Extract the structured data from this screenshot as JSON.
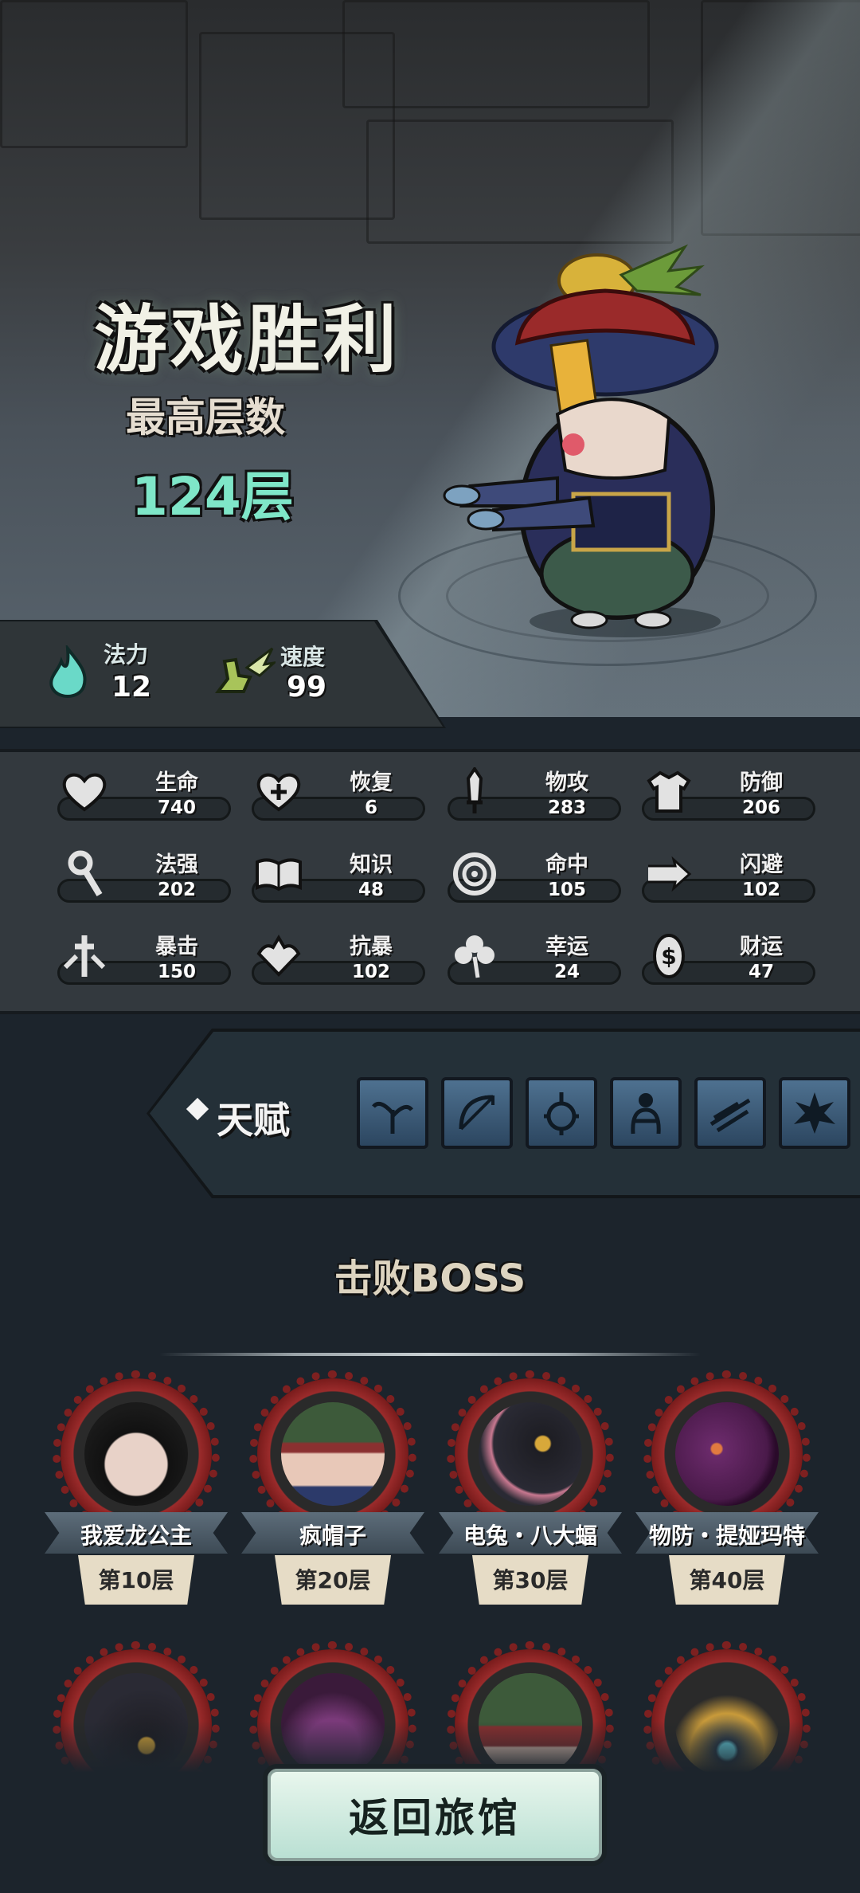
{
  "result": {
    "title": "游戏胜利",
    "subtitle": "最高层数",
    "highest_floor": "124层"
  },
  "top_stats": [
    {
      "label": "法力",
      "value": "12",
      "icon": "mana-flame-icon"
    },
    {
      "label": "速度",
      "value": "99",
      "icon": "winged-boot-icon"
    }
  ],
  "stats": [
    {
      "label": "生命",
      "value": "740",
      "icon": "heart-icon"
    },
    {
      "label": "恢复",
      "value": "6",
      "icon": "heart-plus-icon"
    },
    {
      "label": "物攻",
      "value": "283",
      "icon": "sword-icon"
    },
    {
      "label": "防御",
      "value": "206",
      "icon": "armor-icon"
    },
    {
      "label": "法强",
      "value": "202",
      "icon": "staff-icon"
    },
    {
      "label": "知识",
      "value": "48",
      "icon": "book-icon"
    },
    {
      "label": "命中",
      "value": "105",
      "icon": "target-icon"
    },
    {
      "label": "闪避",
      "value": "102",
      "icon": "dodge-arrow-icon"
    },
    {
      "label": "暴击",
      "value": "150",
      "icon": "crit-dagger-icon"
    },
    {
      "label": "抗暴",
      "value": "102",
      "icon": "crit-resist-icon"
    },
    {
      "label": "幸运",
      "value": "24",
      "icon": "clover-icon"
    },
    {
      "label": "财运",
      "value": "47",
      "icon": "coin-icon"
    }
  ],
  "talent": {
    "label": "天赋",
    "icons": [
      "sprout-icon",
      "bow-icon",
      "totem-icon",
      "hug-icon",
      "wing-icon",
      "burst-icon"
    ]
  },
  "bosses": {
    "title": "击败BOSS",
    "list": [
      {
        "name": "我爱龙公主",
        "floor": "第10层"
      },
      {
        "name": "疯帽子",
        "floor": "第20层"
      },
      {
        "name": "电兔・八大蝠",
        "floor": "第30层"
      },
      {
        "name": "物防・提娅玛特",
        "floor": "第40层"
      }
    ]
  },
  "return_button": "返回旅馆"
}
